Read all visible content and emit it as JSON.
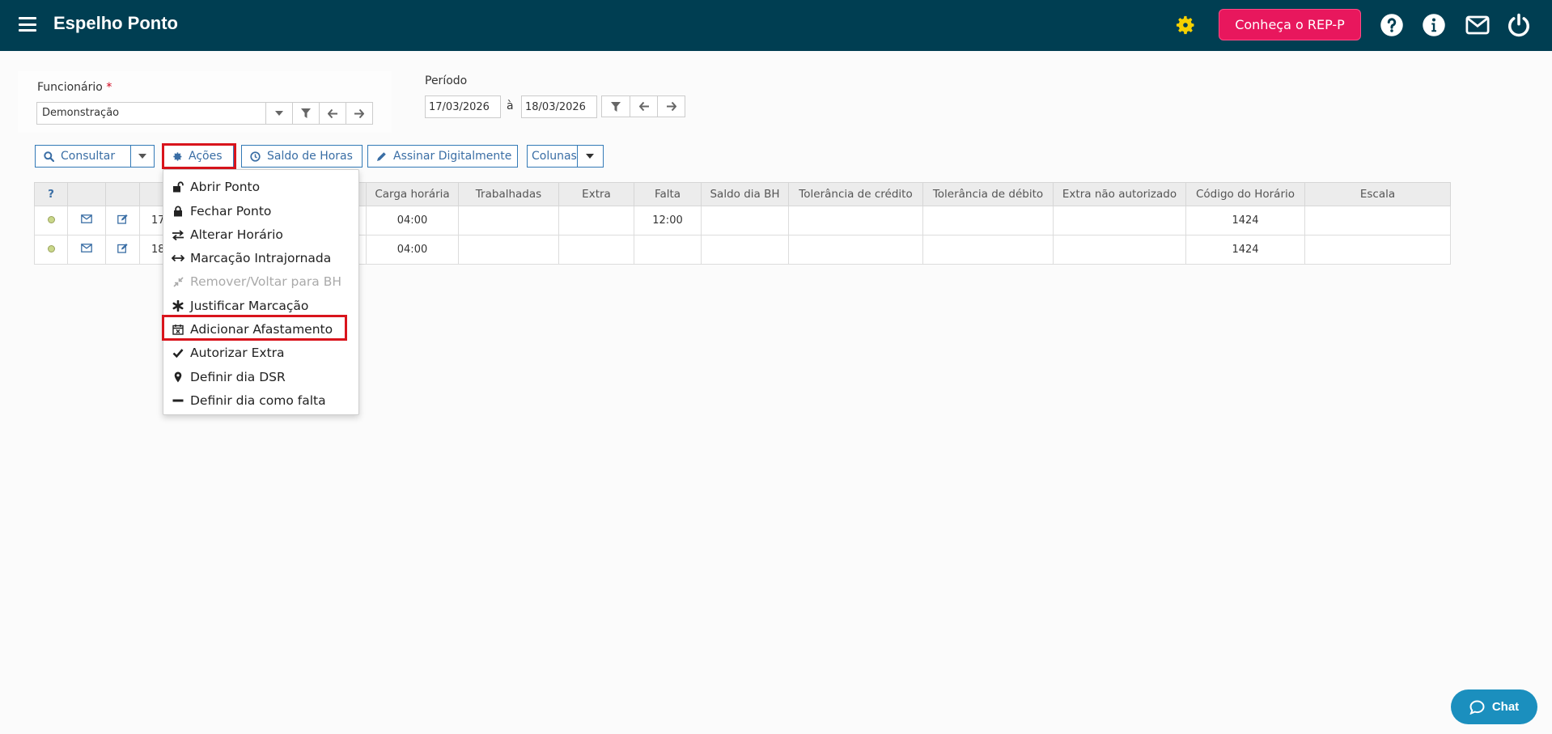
{
  "header": {
    "title": "Espelho Ponto",
    "cta_label": "Conheça o REP-P",
    "icons": [
      "menu-icon",
      "gear-icon",
      "help-icon",
      "info-icon",
      "mail-icon",
      "power-icon"
    ],
    "bar_color": "#003e52",
    "cta_color": "#e8175d"
  },
  "filters": {
    "employee_label": "Funcionário",
    "employee_required_mark": "*",
    "employee_value": "Demonstração",
    "period_label": "Período",
    "date_from": "17/03/2026",
    "date_separator": "à",
    "date_to": "18/03/2026"
  },
  "toolbar": {
    "consultar": "Consultar",
    "acoes": "Ações",
    "saldo": "Saldo de Horas",
    "assinar": "Assinar Digitalmente",
    "colunas": "Colunas"
  },
  "table": {
    "help_header": "?",
    "columns": [
      "Carga horária",
      "Trabalhadas",
      "Extra",
      "Falta",
      "Saldo dia BH",
      "Tolerância de crédito",
      "Tolerância de débito",
      "Extra não autorizado",
      "Código do Horário",
      "Escala"
    ],
    "rows": [
      {
        "date_partial": "17",
        "carga": "04:00",
        "trabalhadas": "",
        "extra": "",
        "falta": "12:00",
        "saldo": "",
        "tol_cred": "",
        "tol_deb": "",
        "extra_na": "",
        "codigo": "1424",
        "escala": ""
      },
      {
        "date_partial": "18",
        "carga": "04:00",
        "trabalhadas": "",
        "extra": "",
        "falta": "",
        "saldo": "",
        "tol_cred": "",
        "tol_deb": "",
        "extra_na": "",
        "codigo": "1424",
        "escala": ""
      }
    ]
  },
  "actions_menu": {
    "items": [
      {
        "label": "Abrir Ponto",
        "icon": "unlock-icon",
        "disabled": false
      },
      {
        "label": "Fechar Ponto",
        "icon": "lock-icon",
        "disabled": false
      },
      {
        "label": "Alterar Horário",
        "icon": "exchange-icon",
        "disabled": false
      },
      {
        "label": "Marcação Intrajornada",
        "icon": "arrows-h-icon",
        "disabled": false
      },
      {
        "label": "Remover/Voltar para BH",
        "icon": "compress-icon",
        "disabled": true
      },
      {
        "label": "Justificar Marcação",
        "icon": "asterisk-icon",
        "disabled": false
      },
      {
        "label": "Adicionar Afastamento",
        "icon": "calendar-x-icon",
        "disabled": false
      },
      {
        "label": "Autorizar Extra",
        "icon": "check-icon",
        "disabled": false
      },
      {
        "label": "Definir dia DSR",
        "icon": "map-marker-icon",
        "disabled": false
      },
      {
        "label": "Definir dia como falta",
        "icon": "minus-icon",
        "disabled": false
      }
    ]
  },
  "chat": {
    "label": "Chat",
    "color": "#1b8fbe"
  },
  "highlight_color": "#d9141c"
}
